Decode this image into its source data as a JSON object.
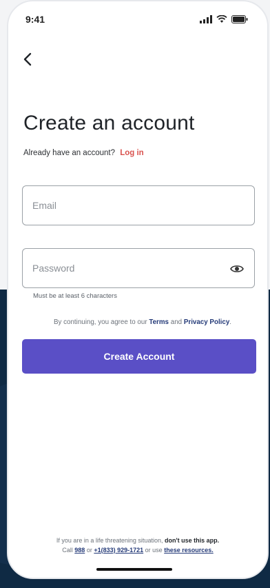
{
  "status_bar": {
    "time": "9:41",
    "icons": [
      "cellular-signal-icon",
      "wifi-icon",
      "battery-icon"
    ]
  },
  "navigation": {
    "back_icon": "chevron-left-icon"
  },
  "header": {
    "title": "Create an account",
    "signin_prompt": "Already have an account?",
    "signin_link": "Log in"
  },
  "form": {
    "email": {
      "placeholder": "Email",
      "value": ""
    },
    "password": {
      "placeholder": "Password",
      "value": "",
      "hint": "Must be at least 6 characters",
      "toggle_icon": "eye-icon"
    },
    "terms": {
      "prefix": "By continuing, you agree to our",
      "terms_label": "Terms",
      "and": "and",
      "privacy_label": "Privacy Policy",
      "suffix": "."
    },
    "submit_label": "Create Account"
  },
  "footer": {
    "line1_text": "If you are in a life threatening situation,",
    "line1_bold": "don't use this app.",
    "line2_call": "Call",
    "line2_number1": "988",
    "line2_or": "or",
    "line2_number2": "+1(833) 929-1721",
    "line2_or_use": "or use",
    "line2_resources": "these resources."
  },
  "colors": {
    "primary_button": "#5a4fc6",
    "login_link": "#d9534f",
    "link": "#243a78",
    "backdrop": "#0f2a44"
  }
}
